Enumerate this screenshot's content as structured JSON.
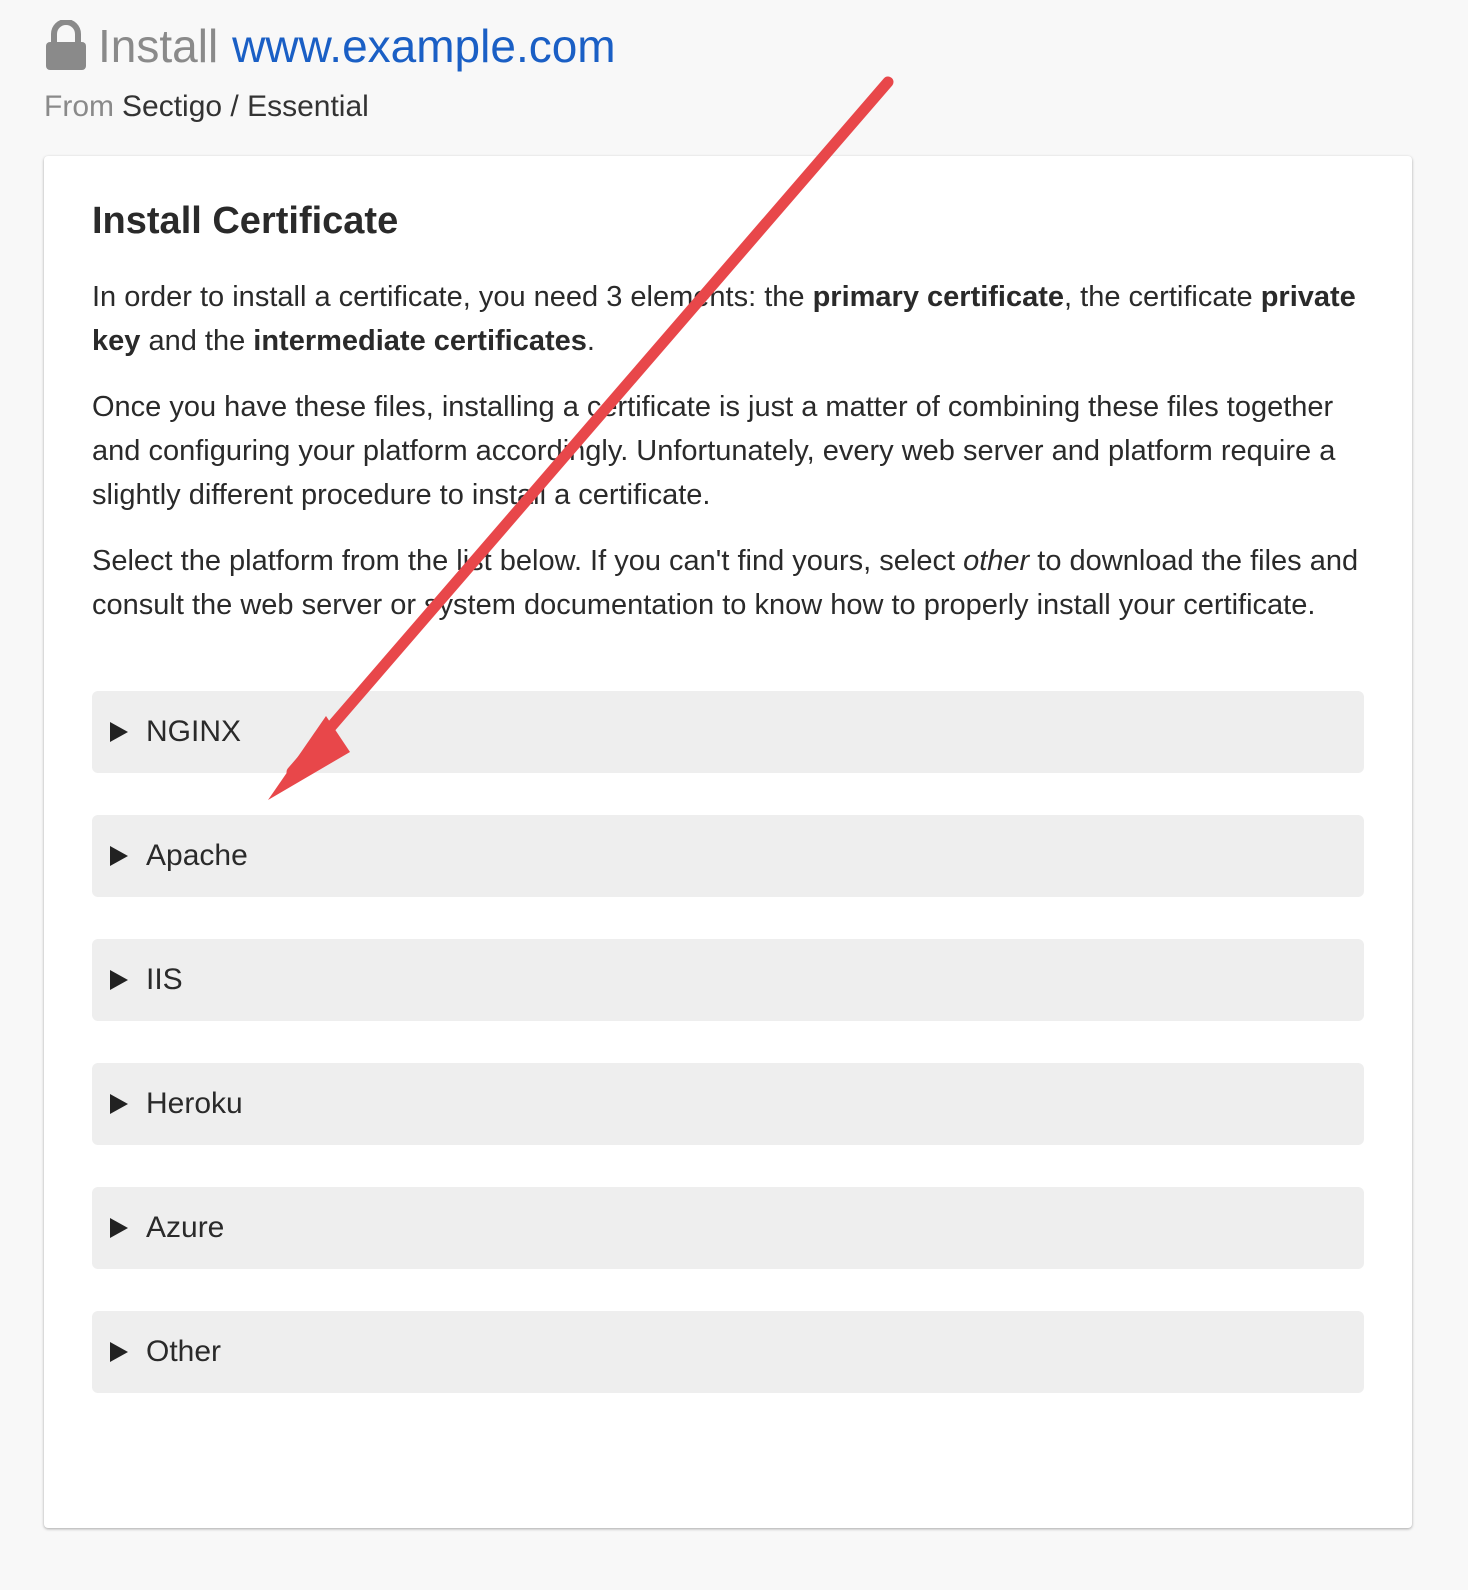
{
  "header": {
    "title_prefix": "Install",
    "domain": "www.example.com",
    "from_label": "From",
    "product": "Sectigo / Essential"
  },
  "card": {
    "heading": "Install Certificate",
    "para1": {
      "t1": "In order to install a certificate, you need 3 elements: the ",
      "b1": "primary certificate",
      "t2": ", the certificate ",
      "b2": "private key",
      "t3": " and the ",
      "b3": "intermediate certificates",
      "t4": "."
    },
    "para2": "Once you have these files, installing a certificate is just a matter of combining these files together and configuring your platform accordingly. Unfortunately, every web server and platform require a slightly different procedure to install a certificate.",
    "para3": {
      "t1": "Select the platform from the list below. If you can't find yours, select ",
      "em": "other",
      "t2": " to download the files and consult the web server or system documentation to know how to properly install your certificate."
    },
    "platforms": [
      {
        "label": "NGINX"
      },
      {
        "label": "Apache"
      },
      {
        "label": "IIS"
      },
      {
        "label": "Heroku"
      },
      {
        "label": "Azure"
      },
      {
        "label": "Other"
      }
    ]
  },
  "colors": {
    "link": "#1a5fc5",
    "muted": "#8a8a8a",
    "panel": "#eeeeee",
    "annotation_arrow": "#e8474a"
  },
  "icons": {
    "lock": "lock-icon",
    "expand": "triangle-right-icon"
  }
}
